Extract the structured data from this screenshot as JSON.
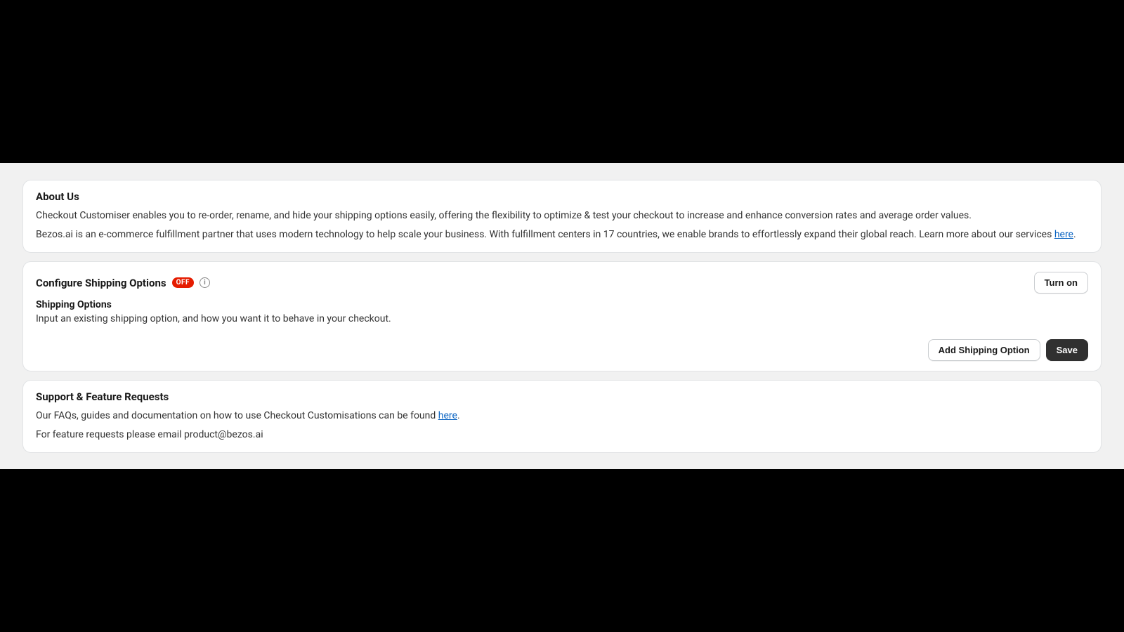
{
  "about": {
    "title": "About Us",
    "line1": "Checkout Customiser enables you to re-order, rename, and hide your shipping options easily, offering the flexibility to optimize & test your checkout to increase and enhance conversion rates and average order values.",
    "line2_a": "Bezos.ai is an e-commerce fulfillment partner that uses modern technology to help scale your business. With fulfillment centers in 17 countries, we enable brands to effortlessly expand their global reach. Learn more about our services ",
    "line2_link": "here",
    "line2_b": "."
  },
  "config": {
    "title": "Configure Shipping Options",
    "badge": "OFF",
    "info_glyph": "i",
    "turn_on_label": "Turn on",
    "sub_title": "Shipping Options",
    "sub_text": "Input an existing shipping option, and how you want it to behave in your checkout.",
    "add_label": "Add Shipping Option",
    "save_label": "Save"
  },
  "support": {
    "title": "Support & Feature Requests",
    "line1_a": "Our FAQs, guides and documentation on how to use Checkout Customisations can be found ",
    "line1_link": "here",
    "line1_b": ".",
    "line2": "For feature requests please email product@bezos.ai"
  }
}
